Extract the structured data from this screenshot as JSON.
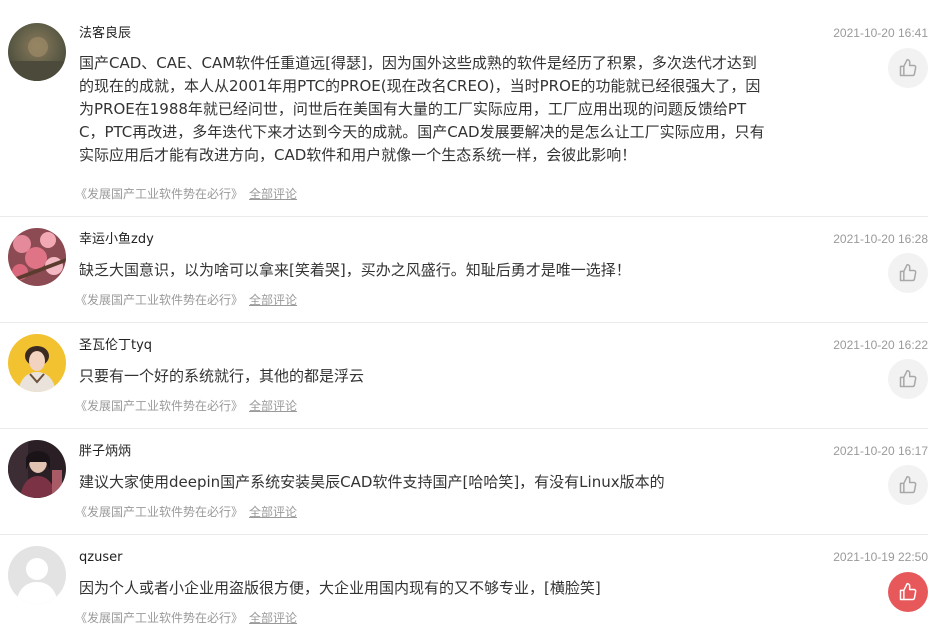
{
  "comments": [
    {
      "user": "法客良辰",
      "time": "2021-10-20 16:41",
      "text": "国产CAD、CAE、CAM软件任重道远[得瑟]，因为国外这些成熟的软件是经历了积累，多次迭代才达到的现在的成就，本人从2001年用PTC的PROE(现在改名CREO)，当时PROE的功能就已经很强大了，因为PROE在1988年就已经问世，问世后在美国有大量的工厂实际应用，工厂应用出现的问题反馈给PTC，PTC再改进，多年迭代下来才达到今天的成就。国产CAD发展要解决的是怎么让工厂实际应用，只有实际应用后才能有改进方向，CAD软件和用户就像一个生态系统一样，会彼此影响！",
      "article": "《发展国产工业软件势在必行》",
      "all_comments": "全部评论",
      "liked": false,
      "avatar_icon": "landscape-avatar-icon"
    },
    {
      "user": "幸运小鱼zdy",
      "time": "2021-10-20 16:28",
      "text": "缺乏大国意识，以为啥可以拿来[笑着哭]，买办之风盛行。知耻后勇才是唯一选择！",
      "article": "《发展国产工业软件势在必行》",
      "all_comments": "全部评论",
      "liked": false,
      "avatar_icon": "flower-avatar-icon"
    },
    {
      "user": "圣瓦伦丁tyq",
      "time": "2021-10-20 16:22",
      "text": "只要有一个好的系统就行，其他的都是浮云",
      "article": "《发展国产工业软件势在必行》",
      "all_comments": "全部评论",
      "liked": false,
      "avatar_icon": "portrait-avatar-icon"
    },
    {
      "user": "胖子炳炳",
      "time": "2021-10-20 16:17",
      "text": "建议大家使用deepin国产系统安装昊辰CAD软件支持国产[哈哈笑]，有没有Linux版本的",
      "article": "《发展国产工业软件势在必行》",
      "all_comments": "全部评论",
      "liked": false,
      "avatar_icon": "person-photo-avatar-icon"
    },
    {
      "user": "qzuser",
      "time": "2021-10-19 22:50",
      "text": "因为个人或者小企业用盗版很方便，大企业用国内现有的又不够专业，[横脸笑]",
      "article": "《发展国产工业软件势在必行》",
      "all_comments": "全部评论",
      "liked": true,
      "avatar_icon": "default-user-avatar-icon"
    }
  ],
  "colors": {
    "like_active": "#e7585b",
    "like_inactive": "#f2f2f2",
    "meta_text": "#9a9a9a",
    "divider": "#ebebeb"
  }
}
